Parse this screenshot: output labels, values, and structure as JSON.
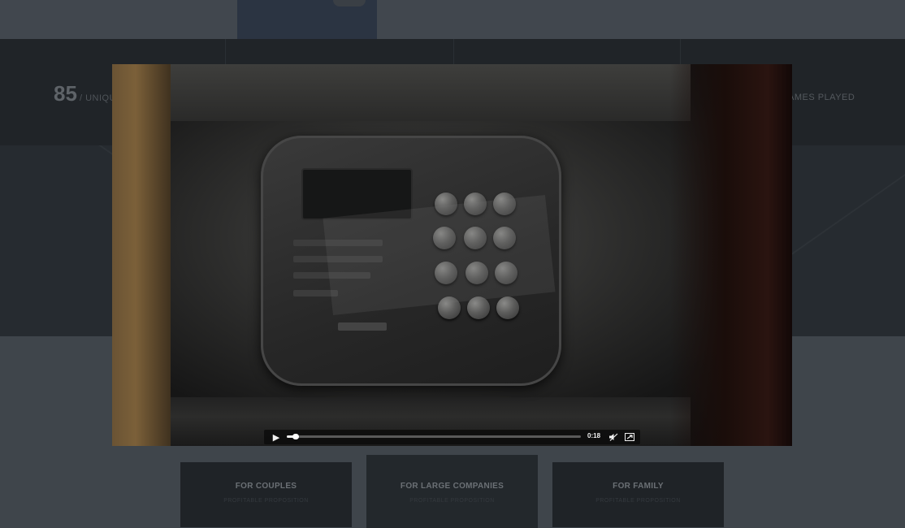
{
  "stats": {
    "left_number": "85",
    "left_label": "/ UNIQU",
    "right_label": "AMES PLAYED"
  },
  "cards": [
    {
      "title": "FOR COUPLES",
      "subtitle": "PROFITABLE PROPOSITION"
    },
    {
      "title": "FOR LARGE COMPANIES",
      "subtitle": "PROFITABLE PROPOSITION"
    },
    {
      "title": "FOR FAMILY",
      "subtitle": "PROFITABLE PROPOSITION"
    }
  ],
  "video": {
    "time": "0:18",
    "progress": 0.03,
    "play_icon": "play-icon",
    "volume_icon": "volume-muted-icon",
    "fullscreen_icon": "fullscreen-icon"
  },
  "colors": {
    "overlay_bg": "#3f454b",
    "stats_bg": "#202428",
    "card_bg": "#1f2327",
    "player_bar": "#0a0a0a"
  }
}
